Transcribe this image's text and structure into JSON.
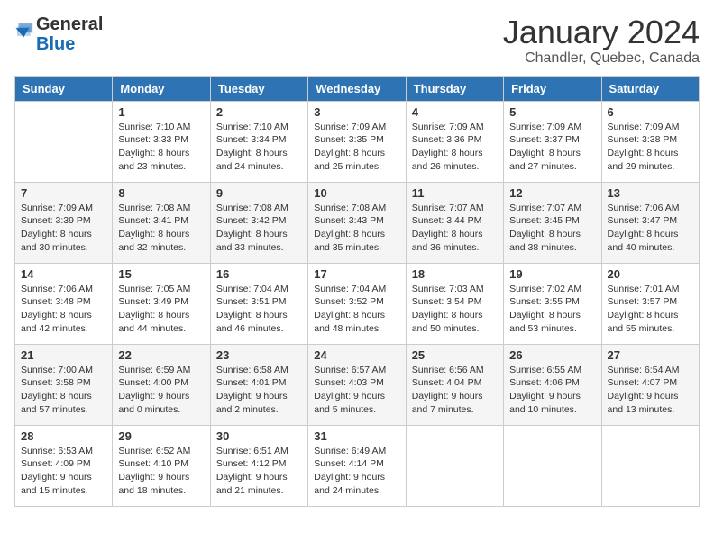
{
  "header": {
    "logo_general": "General",
    "logo_blue": "Blue",
    "month_year": "January 2024",
    "location": "Chandler, Quebec, Canada"
  },
  "weekdays": [
    "Sunday",
    "Monday",
    "Tuesday",
    "Wednesday",
    "Thursday",
    "Friday",
    "Saturday"
  ],
  "weeks": [
    [
      {
        "day": "",
        "sunrise": "",
        "sunset": "",
        "daylight": ""
      },
      {
        "day": "1",
        "sunrise": "Sunrise: 7:10 AM",
        "sunset": "Sunset: 3:33 PM",
        "daylight": "Daylight: 8 hours and 23 minutes."
      },
      {
        "day": "2",
        "sunrise": "Sunrise: 7:10 AM",
        "sunset": "Sunset: 3:34 PM",
        "daylight": "Daylight: 8 hours and 24 minutes."
      },
      {
        "day": "3",
        "sunrise": "Sunrise: 7:09 AM",
        "sunset": "Sunset: 3:35 PM",
        "daylight": "Daylight: 8 hours and 25 minutes."
      },
      {
        "day": "4",
        "sunrise": "Sunrise: 7:09 AM",
        "sunset": "Sunset: 3:36 PM",
        "daylight": "Daylight: 8 hours and 26 minutes."
      },
      {
        "day": "5",
        "sunrise": "Sunrise: 7:09 AM",
        "sunset": "Sunset: 3:37 PM",
        "daylight": "Daylight: 8 hours and 27 minutes."
      },
      {
        "day": "6",
        "sunrise": "Sunrise: 7:09 AM",
        "sunset": "Sunset: 3:38 PM",
        "daylight": "Daylight: 8 hours and 29 minutes."
      }
    ],
    [
      {
        "day": "7",
        "sunrise": "Sunrise: 7:09 AM",
        "sunset": "Sunset: 3:39 PM",
        "daylight": "Daylight: 8 hours and 30 minutes."
      },
      {
        "day": "8",
        "sunrise": "Sunrise: 7:08 AM",
        "sunset": "Sunset: 3:41 PM",
        "daylight": "Daylight: 8 hours and 32 minutes."
      },
      {
        "day": "9",
        "sunrise": "Sunrise: 7:08 AM",
        "sunset": "Sunset: 3:42 PM",
        "daylight": "Daylight: 8 hours and 33 minutes."
      },
      {
        "day": "10",
        "sunrise": "Sunrise: 7:08 AM",
        "sunset": "Sunset: 3:43 PM",
        "daylight": "Daylight: 8 hours and 35 minutes."
      },
      {
        "day": "11",
        "sunrise": "Sunrise: 7:07 AM",
        "sunset": "Sunset: 3:44 PM",
        "daylight": "Daylight: 8 hours and 36 minutes."
      },
      {
        "day": "12",
        "sunrise": "Sunrise: 7:07 AM",
        "sunset": "Sunset: 3:45 PM",
        "daylight": "Daylight: 8 hours and 38 minutes."
      },
      {
        "day": "13",
        "sunrise": "Sunrise: 7:06 AM",
        "sunset": "Sunset: 3:47 PM",
        "daylight": "Daylight: 8 hours and 40 minutes."
      }
    ],
    [
      {
        "day": "14",
        "sunrise": "Sunrise: 7:06 AM",
        "sunset": "Sunset: 3:48 PM",
        "daylight": "Daylight: 8 hours and 42 minutes."
      },
      {
        "day": "15",
        "sunrise": "Sunrise: 7:05 AM",
        "sunset": "Sunset: 3:49 PM",
        "daylight": "Daylight: 8 hours and 44 minutes."
      },
      {
        "day": "16",
        "sunrise": "Sunrise: 7:04 AM",
        "sunset": "Sunset: 3:51 PM",
        "daylight": "Daylight: 8 hours and 46 minutes."
      },
      {
        "day": "17",
        "sunrise": "Sunrise: 7:04 AM",
        "sunset": "Sunset: 3:52 PM",
        "daylight": "Daylight: 8 hours and 48 minutes."
      },
      {
        "day": "18",
        "sunrise": "Sunrise: 7:03 AM",
        "sunset": "Sunset: 3:54 PM",
        "daylight": "Daylight: 8 hours and 50 minutes."
      },
      {
        "day": "19",
        "sunrise": "Sunrise: 7:02 AM",
        "sunset": "Sunset: 3:55 PM",
        "daylight": "Daylight: 8 hours and 53 minutes."
      },
      {
        "day": "20",
        "sunrise": "Sunrise: 7:01 AM",
        "sunset": "Sunset: 3:57 PM",
        "daylight": "Daylight: 8 hours and 55 minutes."
      }
    ],
    [
      {
        "day": "21",
        "sunrise": "Sunrise: 7:00 AM",
        "sunset": "Sunset: 3:58 PM",
        "daylight": "Daylight: 8 hours and 57 minutes."
      },
      {
        "day": "22",
        "sunrise": "Sunrise: 6:59 AM",
        "sunset": "Sunset: 4:00 PM",
        "daylight": "Daylight: 9 hours and 0 minutes."
      },
      {
        "day": "23",
        "sunrise": "Sunrise: 6:58 AM",
        "sunset": "Sunset: 4:01 PM",
        "daylight": "Daylight: 9 hours and 2 minutes."
      },
      {
        "day": "24",
        "sunrise": "Sunrise: 6:57 AM",
        "sunset": "Sunset: 4:03 PM",
        "daylight": "Daylight: 9 hours and 5 minutes."
      },
      {
        "day": "25",
        "sunrise": "Sunrise: 6:56 AM",
        "sunset": "Sunset: 4:04 PM",
        "daylight": "Daylight: 9 hours and 7 minutes."
      },
      {
        "day": "26",
        "sunrise": "Sunrise: 6:55 AM",
        "sunset": "Sunset: 4:06 PM",
        "daylight": "Daylight: 9 hours and 10 minutes."
      },
      {
        "day": "27",
        "sunrise": "Sunrise: 6:54 AM",
        "sunset": "Sunset: 4:07 PM",
        "daylight": "Daylight: 9 hours and 13 minutes."
      }
    ],
    [
      {
        "day": "28",
        "sunrise": "Sunrise: 6:53 AM",
        "sunset": "Sunset: 4:09 PM",
        "daylight": "Daylight: 9 hours and 15 minutes."
      },
      {
        "day": "29",
        "sunrise": "Sunrise: 6:52 AM",
        "sunset": "Sunset: 4:10 PM",
        "daylight": "Daylight: 9 hours and 18 minutes."
      },
      {
        "day": "30",
        "sunrise": "Sunrise: 6:51 AM",
        "sunset": "Sunset: 4:12 PM",
        "daylight": "Daylight: 9 hours and 21 minutes."
      },
      {
        "day": "31",
        "sunrise": "Sunrise: 6:49 AM",
        "sunset": "Sunset: 4:14 PM",
        "daylight": "Daylight: 9 hours and 24 minutes."
      },
      {
        "day": "",
        "sunrise": "",
        "sunset": "",
        "daylight": ""
      },
      {
        "day": "",
        "sunrise": "",
        "sunset": "",
        "daylight": ""
      },
      {
        "day": "",
        "sunrise": "",
        "sunset": "",
        "daylight": ""
      }
    ]
  ]
}
